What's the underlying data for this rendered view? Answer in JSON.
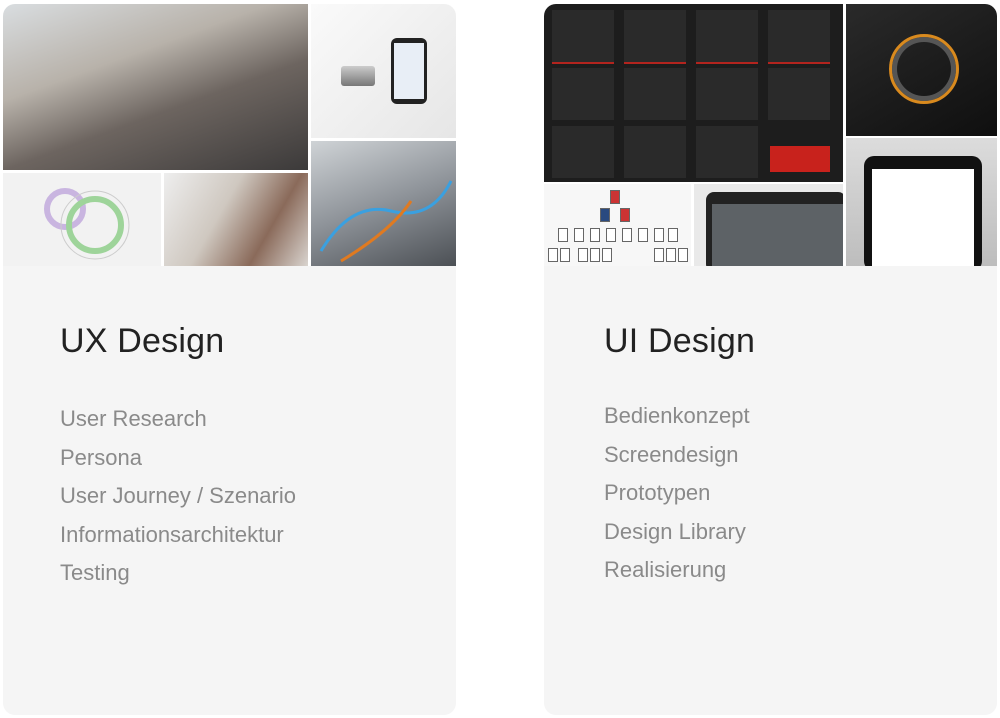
{
  "cards": [
    {
      "title": "UX Design",
      "items": [
        "User Research",
        "Persona",
        "User Journey / Szenario",
        "Informationsarchitektur",
        "Testing"
      ]
    },
    {
      "title": "UI Design",
      "items": [
        "Bedienkonzept",
        "Screendesign",
        "Prototypen",
        "Design Library",
        "Realisierung"
      ]
    }
  ],
  "colors": {
    "card_bg": "#f5f5f5",
    "title": "#222222",
    "item": "#8a8a8a",
    "accent_red": "#b3241e",
    "accent_orange": "#d98a1e"
  }
}
